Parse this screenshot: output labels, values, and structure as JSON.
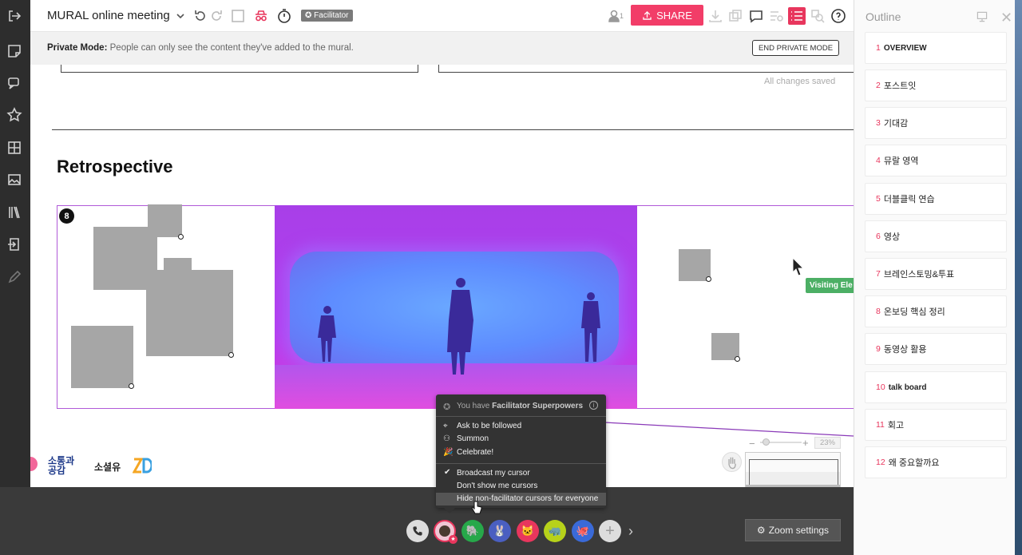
{
  "header": {
    "board_title": "MURAL online meeting",
    "facilitator_badge": "Facilitator",
    "participant_count": "1",
    "share_label": "SHARE"
  },
  "private_mode": {
    "label": "Private Mode:",
    "message": "People can only see the content they've added to the mural.",
    "end_button": "END PRIVATE MODE"
  },
  "canvas": {
    "save_status": "All changes saved",
    "section_title": "Retrospective",
    "area_number": "8",
    "visiting_tag": "Visiting Ele",
    "logos": [
      "소통과 공감",
      "소셜유"
    ]
  },
  "zoom": {
    "value": "23%",
    "settings_label": "Zoom settings"
  },
  "facilitator_menu": {
    "header_prefix": "You have ",
    "header_strong": "Facilitator Superpowers",
    "items": [
      {
        "label": "Ask to be followed",
        "icon": "follow-icon"
      },
      {
        "label": "Summon",
        "icon": "summon-icon"
      },
      {
        "label": "Celebrate!",
        "icon": "celebrate-icon"
      }
    ],
    "cursor_options": [
      {
        "label": "Broadcast my cursor",
        "checked": true
      },
      {
        "label": "Don't show me cursors",
        "checked": false
      },
      {
        "label": "Hide non-facilitator cursors for everyone",
        "checked": false
      }
    ]
  },
  "outline": {
    "title": "Outline",
    "items": [
      {
        "num": "1",
        "label": "OVERVIEW"
      },
      {
        "num": "2",
        "label": "포스트잇"
      },
      {
        "num": "3",
        "label": "기대감"
      },
      {
        "num": "4",
        "label": "뮤랄 영역"
      },
      {
        "num": "5",
        "label": "더블클릭 연습"
      },
      {
        "num": "6",
        "label": "영상"
      },
      {
        "num": "7",
        "label": "브레인스토밍&투표"
      },
      {
        "num": "8",
        "label": "온보딩 핵심 정리"
      },
      {
        "num": "9",
        "label": "동영상 활용"
      },
      {
        "num": "10",
        "label": "talk board"
      },
      {
        "num": "11",
        "label": "회고"
      },
      {
        "num": "12",
        "label": "왜 중요할까요"
      }
    ]
  },
  "colors": {
    "accent": "#f23d68",
    "outline_number": "#e8365d",
    "area_border": "#b05ad8",
    "visiting_tag": "#4caf65"
  }
}
